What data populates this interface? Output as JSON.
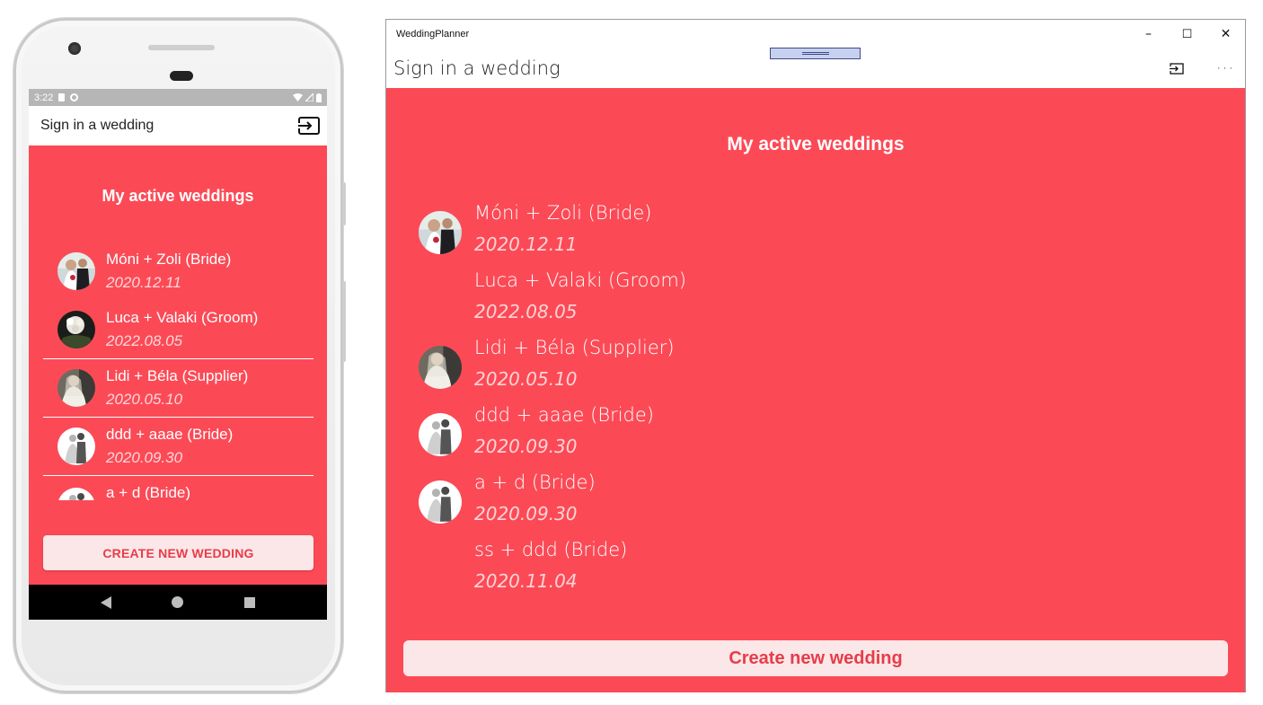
{
  "android": {
    "status_time": "3:22",
    "toolbar_title": "Sign in a wedding",
    "heading": "My active weddings",
    "weddings": [
      {
        "name": "Móni + Zoli (Bride)",
        "date": "2020.12.11",
        "avatar": "couple-photo-icon"
      },
      {
        "name": "Luca + Valaki (Groom)",
        "date": "2022.08.05",
        "avatar": "bouquet-photo-icon"
      },
      {
        "name": "Lidi + Béla (Supplier)",
        "date": "2020.05.10",
        "avatar": "bride-photo-icon"
      },
      {
        "name": "ddd + aaae (Bride)",
        "date": "2020.09.30",
        "avatar": "couple-silhouette-icon"
      },
      {
        "name": "a + d (Bride)",
        "date": "",
        "avatar": "couple-silhouette-icon"
      }
    ],
    "create_button": "CREATE NEW WEDDING"
  },
  "windows": {
    "app_title": "WeddingPlanner",
    "command_title": "Sign in a wedding",
    "heading": "My active weddings",
    "weddings": [
      {
        "name": "Móni + Zoli (Bride)",
        "date": "2020.12.11",
        "avatar": "couple-photo-icon"
      },
      {
        "name": "Luca + Valaki (Groom)",
        "date": "2022.08.05",
        "avatar": ""
      },
      {
        "name": "Lidi + Béla (Supplier)",
        "date": "2020.05.10",
        "avatar": "bride-photo-icon"
      },
      {
        "name": "ddd + aaae (Bride)",
        "date": "2020.09.30",
        "avatar": "couple-silhouette-icon"
      },
      {
        "name": "a + d (Bride)",
        "date": "2020.09.30",
        "avatar": "couple-silhouette-icon"
      },
      {
        "name": "ss + ddd (Bride)",
        "date": "2020.11.04",
        "avatar": ""
      }
    ],
    "create_button": "Create new wedding",
    "window_controls": {
      "minimize": "–",
      "maximize": "☐",
      "close": "✕"
    },
    "more_label": "···"
  },
  "colors": {
    "accent": "#fb4a56",
    "button_bg": "#fbe7e8",
    "button_text": "#e83c49"
  }
}
